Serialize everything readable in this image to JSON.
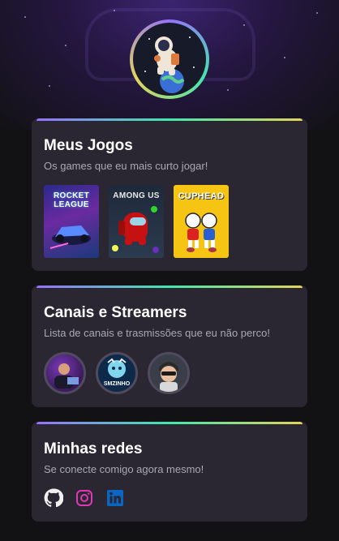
{
  "profile": {
    "avatar_icon": "astronaut-avatar"
  },
  "games_card": {
    "title": "Meus Jogos",
    "subtitle": "Os games que eu mais curto jogar!",
    "games": [
      {
        "name": "ROCKET LEAGUE",
        "icon": "rocket-league-cover"
      },
      {
        "name": "AMONG US",
        "icon": "among-us-cover"
      },
      {
        "name": "CUPHEAD",
        "icon": "cuphead-cover"
      }
    ]
  },
  "channels_card": {
    "title": "Canais e Streamers",
    "subtitle": "Lista de canais e trasmissões que eu não perco!",
    "channels": [
      {
        "icon": "streamer-avatar-1"
      },
      {
        "icon": "streamer-avatar-2",
        "label": "SMZINHO"
      },
      {
        "icon": "streamer-avatar-3"
      }
    ]
  },
  "social_card": {
    "title": "Minhas redes",
    "subtitle": "Se conecte comigo agora mesmo!",
    "links": [
      {
        "icon": "github-icon"
      },
      {
        "icon": "instagram-icon"
      },
      {
        "icon": "linkedin-icon"
      }
    ]
  },
  "colors": {
    "background": "#121214",
    "card": "#2a2733",
    "accent_gradient": [
      "#9572fc",
      "#43e7ad",
      "#e2d45c"
    ]
  }
}
